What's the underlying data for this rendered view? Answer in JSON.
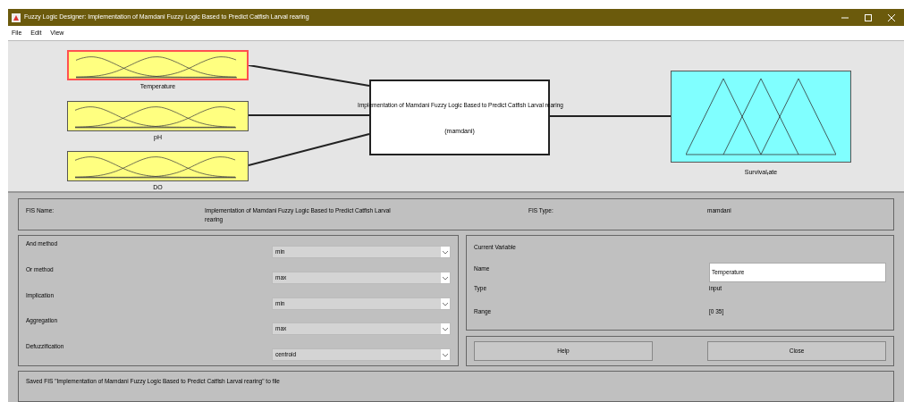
{
  "window": {
    "title": "Fuzzy Logic Designer: Implementation of Mamdani Fuzzy Logic Based to Predict Catfish Larval rearing"
  },
  "menu": [
    "File",
    "Edit",
    "View"
  ],
  "diagram": {
    "inputs": [
      {
        "label": "Temperature",
        "selected": true
      },
      {
        "label": "pH",
        "selected": false
      },
      {
        "label": "DO",
        "selected": false
      }
    ],
    "system": {
      "name": "Implementation of Mamdani Fuzzy Logic Based to Predict Catfish Larval rearing",
      "type": "(mamdani)"
    },
    "output": {
      "label": "Survival$_{r}$ate"
    }
  },
  "fis": {
    "name_label": "FIS Name:",
    "name": "Implementation of Mamdani Fuzzy Logic Based to Predict Catfish Larval rearing",
    "type_label": "FIS Type:",
    "type": "mamdani"
  },
  "methods": [
    {
      "label": "And method",
      "value": "min"
    },
    {
      "label": "Or method",
      "value": "max"
    },
    {
      "label": "Implication",
      "value": "min"
    },
    {
      "label": "Aggregation",
      "value": "max"
    },
    {
      "label": "Defuzzification",
      "value": "centroid"
    }
  ],
  "current_variable": {
    "title": "Current Variable",
    "name_label": "Name",
    "name": "Temperature",
    "type_label": "Type",
    "type": "input",
    "range_label": "Range",
    "range": "[0 35]"
  },
  "buttons": [
    "Help",
    "Close"
  ],
  "status": "Saved FIS \"Implementation of Mamdani Fuzzy Logic Based to Predict Catfish Larval rearing\" to file"
}
